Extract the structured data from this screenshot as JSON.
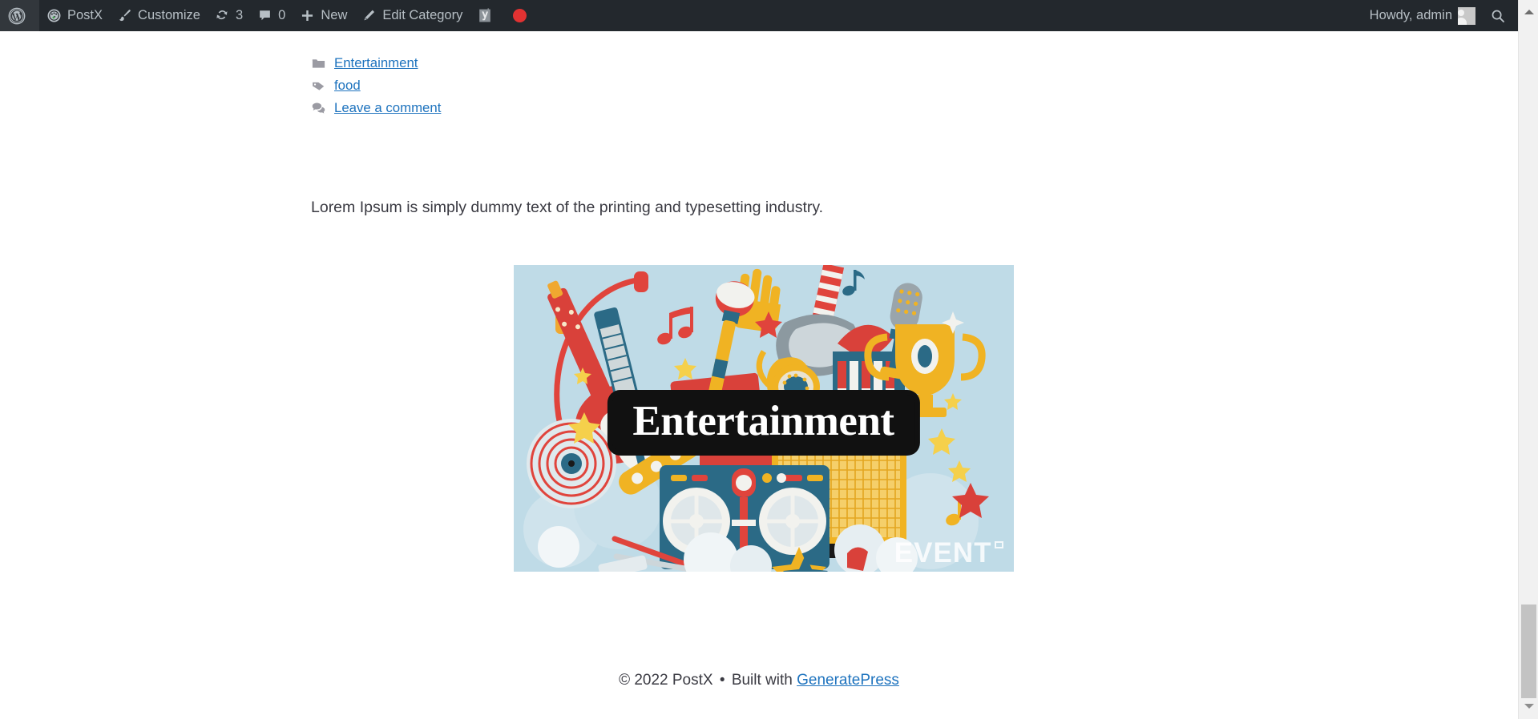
{
  "adminbar": {
    "left_items": [
      {
        "name": "wp-logo",
        "icon": "wordpress-icon",
        "label": "",
        "count": ""
      },
      {
        "name": "postx",
        "icon": "dashboard-icon",
        "label": "PostX",
        "count": ""
      },
      {
        "name": "customize",
        "icon": "paintbrush-icon",
        "label": "Customize",
        "count": ""
      },
      {
        "name": "updates",
        "icon": "update-icon",
        "label": "",
        "count": "3"
      },
      {
        "name": "comments",
        "icon": "comment-bubble-icon",
        "label": "",
        "count": "0"
      },
      {
        "name": "new-content",
        "icon": "plus-icon",
        "label": "New",
        "count": ""
      },
      {
        "name": "edit-category",
        "icon": "pencil-icon",
        "label": "Edit Category",
        "count": ""
      },
      {
        "name": "yoast-seo",
        "icon": "yoast-icon",
        "label": "",
        "count": ""
      },
      {
        "name": "recording-indicator",
        "icon": "red-dot-icon",
        "label": "",
        "count": ""
      }
    ],
    "howdy": "Howdy, admin",
    "search_icon": "search-icon",
    "avatar": "avatar",
    "bar_color": "#23282d",
    "text_color": "#b7bfc5",
    "dot_color": "#e13232"
  },
  "entry_meta": {
    "categories": {
      "icon": "folder-icon",
      "link": "Entertainment"
    },
    "tags": {
      "icon": "tag-icon",
      "link": "food"
    },
    "comments": {
      "icon": "comments-icon",
      "link": "Leave a comment"
    },
    "link_color": "#1e73be"
  },
  "content": {
    "paragraph": "Lorem Ipsum is simply dummy text of the printing and typesetting industry.",
    "featured_image": {
      "name": "featured-image-entertainment",
      "banner_text": "Entertainment",
      "watermark_text": "EVENT",
      "background_color": "#bfdbe7",
      "alt": "Entertainment illustration collage with guitar, microphones, trophy, piano, boombox and music notes"
    }
  },
  "footer": {
    "copyright": "© 2022 PostX",
    "separator": "•",
    "built_with": "Built with",
    "link": "GeneratePress"
  },
  "scrollbar": {
    "up_arrow": "scroll-up-arrow-icon",
    "down_arrow": "scroll-down-arrow-icon",
    "thumb": "scrollbar-thumb"
  }
}
